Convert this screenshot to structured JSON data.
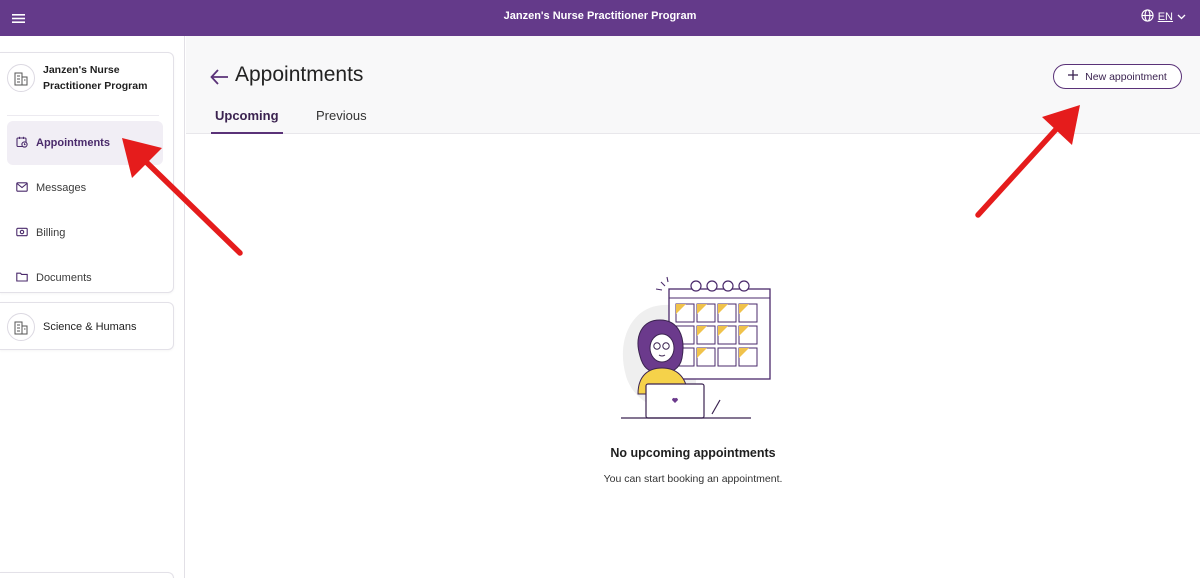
{
  "header": {
    "title": "Janzen's Nurse Practitioner Program",
    "language": "EN"
  },
  "sidebar": {
    "org_primary": "Janzen's Nurse Practitioner Program",
    "items": [
      {
        "label": "Appointments",
        "icon": "calendar-clock-icon",
        "active": true
      },
      {
        "label": "Messages",
        "icon": "envelope-icon",
        "active": false
      },
      {
        "label": "Billing",
        "icon": "money-icon",
        "active": false
      },
      {
        "label": "Documents",
        "icon": "folder-icon",
        "active": false
      }
    ],
    "org_secondary": "Science & Humans"
  },
  "main": {
    "title": "Appointments",
    "new_button_label": "New appointment",
    "tabs": [
      {
        "label": "Upcoming",
        "active": true
      },
      {
        "label": "Previous",
        "active": false
      }
    ],
    "empty_title": "No upcoming appointments",
    "empty_subtitle": "You can start booking an appointment."
  },
  "colors": {
    "brand": "#643a8a",
    "accent": "#5a3278",
    "annotation_arrow": "#e51c1c"
  }
}
